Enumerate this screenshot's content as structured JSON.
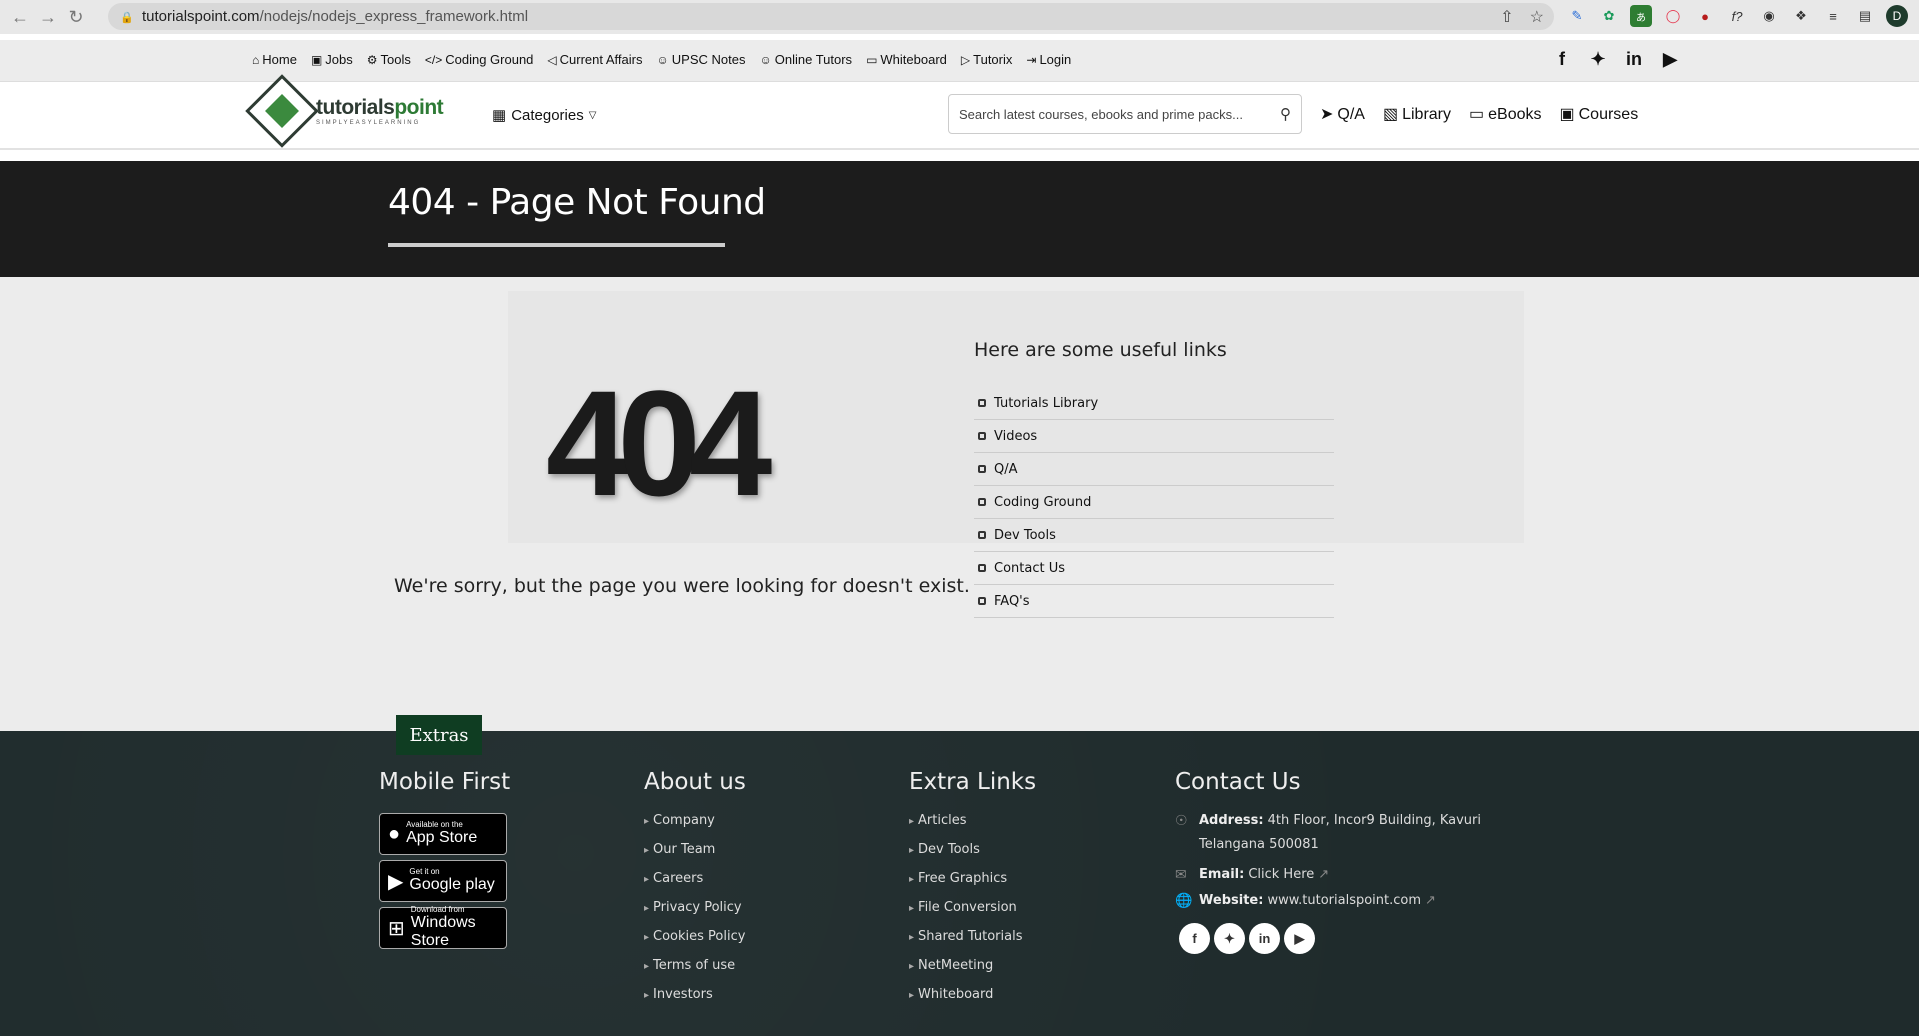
{
  "browser": {
    "url_host": "tutorialspoint.com",
    "url_path": "/nodejs/nodejs_express_framework.html",
    "avatar_letter": "D"
  },
  "topbar": {
    "links": [
      {
        "label": "Home",
        "icon": "home-icon"
      },
      {
        "label": "Jobs",
        "icon": "briefcase-icon"
      },
      {
        "label": "Tools",
        "icon": "gears-icon"
      },
      {
        "label": "Coding Ground",
        "icon": "code-icon"
      },
      {
        "label": "Current Affairs",
        "icon": "megaphone-icon"
      },
      {
        "label": "UPSC Notes",
        "icon": "user-icon"
      },
      {
        "label": "Online Tutors",
        "icon": "user-icon"
      },
      {
        "label": "Whiteboard",
        "icon": "board-icon"
      },
      {
        "label": "Tutorix",
        "icon": "video-icon"
      },
      {
        "label": "Login",
        "icon": "login-icon"
      }
    ],
    "social": [
      "facebook-icon",
      "twitter-icon",
      "linkedin-icon",
      "youtube-icon"
    ]
  },
  "header": {
    "logo_text_1": "tutorials",
    "logo_text_2": "point",
    "logo_sub": "SIMPLYEASYLEARNING",
    "categories_label": "Categories",
    "search_placeholder": "Search latest courses, ebooks and prime packs...",
    "links": [
      "Q/A",
      "Library",
      "eBooks",
      "Courses"
    ]
  },
  "banner": {
    "title": "404 - Page Not Found"
  },
  "main": {
    "code": "404",
    "sorry_text": "We're sorry, but the page you were looking for doesn't exist.",
    "useful_title": "Here are some useful links",
    "useful_links": [
      "Tutorials Library",
      "Videos",
      "Q/A",
      "Coding Ground",
      "Dev Tools",
      "Contact Us",
      "FAQ's"
    ]
  },
  "footer": {
    "extras_label": "Extras",
    "mobile_title": "Mobile First",
    "stores": [
      {
        "top": "Available on the",
        "bottom": "App Store",
        "icon": "apple-icon"
      },
      {
        "top": "Get it on",
        "bottom": "Google play",
        "icon": "google-play-icon"
      },
      {
        "top": "Download from",
        "bottom": "Windows Store",
        "icon": "windows-icon"
      }
    ],
    "about_title": "About us",
    "about_links": [
      "Company",
      "Our Team",
      "Careers",
      "Privacy Policy",
      "Cookies Policy",
      "Terms of use",
      "Investors"
    ],
    "extra_title": "Extra Links",
    "extra_links": [
      "Articles",
      "Dev Tools",
      "Free Graphics",
      "File Conversion",
      "Shared Tutorials",
      "NetMeeting",
      "Whiteboard"
    ],
    "contact_title": "Contact Us",
    "address_label": "Address:",
    "address_line1": "4th Floor, Incor9 Building, Kavuri",
    "address_line2": "Telangana 500081",
    "email_label": "Email:",
    "email_value": "Click Here",
    "website_label": "Website:",
    "website_value": "www.tutorialspoint.com"
  }
}
